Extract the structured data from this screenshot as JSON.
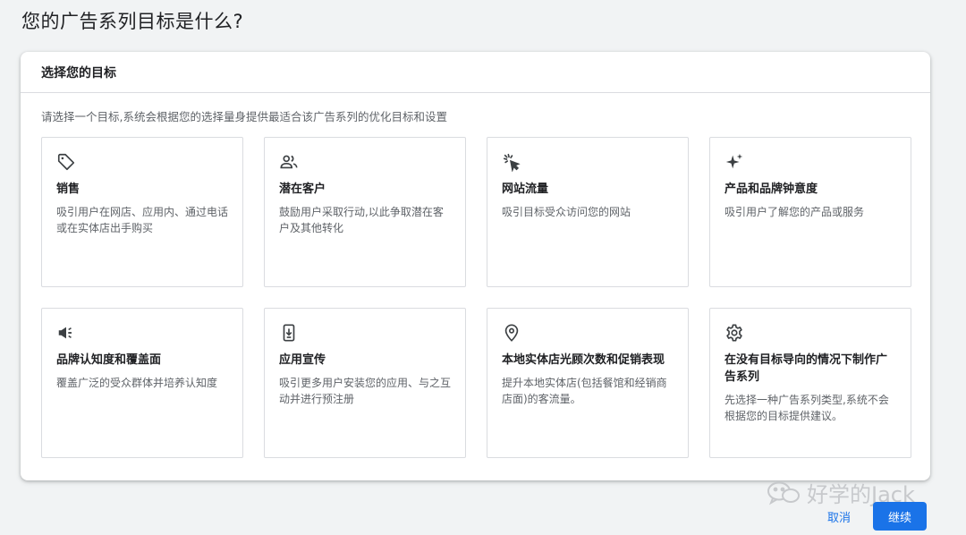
{
  "page": {
    "title": "您的广告系列目标是什么?"
  },
  "panel": {
    "header": "选择您的目标",
    "description": "请选择一个目标,系统会根据您的选择量身提供最适合该广告系列的优化目标和设置"
  },
  "goals": [
    {
      "icon": "tag-icon",
      "title": "销售",
      "description": "吸引用户在网店、应用内、通过电话或在实体店出手购买"
    },
    {
      "icon": "people-icon",
      "title": "潜在客户",
      "description": "鼓励用户采取行动,以此争取潜在客户及其他转化"
    },
    {
      "icon": "cursor-click-icon",
      "title": "网站流量",
      "description": "吸引目标受众访问您的网站"
    },
    {
      "icon": "sparkle-icon",
      "title": "产品和品牌钟意度",
      "description": "吸引用户了解您的产品或服务"
    },
    {
      "icon": "megaphone-icon",
      "title": "品牌认知度和覆盖面",
      "description": "覆盖广泛的受众群体并培养认知度"
    },
    {
      "icon": "phone-download-icon",
      "title": "应用宣传",
      "description": "吸引更多用户安装您的应用、与之互动并进行预注册"
    },
    {
      "icon": "location-pin-icon",
      "title": "本地实体店光顾次数和促销表现",
      "description": "提升本地实体店(包括餐馆和经销商店面)的客流量。"
    },
    {
      "icon": "gear-icon",
      "title": "在没有目标导向的情况下制作广告系列",
      "description": "先选择一种广告系列类型,系统不会根据您的目标提供建议。"
    }
  ],
  "actions": {
    "cancel_label": "取消",
    "continue_label": "继续"
  },
  "watermark": {
    "text": "好学的Jack",
    "icon": "wechat-icon"
  },
  "colors": {
    "accent": "#1a73e8",
    "background": "#f1f3f4",
    "card_border": "#dadce0"
  }
}
